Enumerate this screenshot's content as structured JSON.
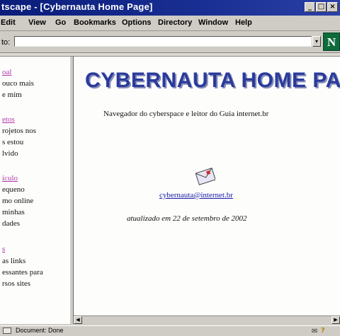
{
  "window": {
    "title": "tscape - [Cybernauta Home Page]",
    "controls": [
      "_",
      "□",
      "×"
    ]
  },
  "menu": [
    {
      "label": "Edit"
    },
    {
      "label": "View"
    },
    {
      "label": "Go"
    },
    {
      "label": "Bookmarks"
    },
    {
      "label": "Options"
    },
    {
      "label": "Directory"
    },
    {
      "label": "Window"
    },
    {
      "label": "Help"
    }
  ],
  "location": {
    "label": "to:",
    "value": "",
    "dropdown_icon": "▾",
    "logo": "N"
  },
  "sidebar": {
    "sections": [
      {
        "heading": "oal",
        "lines": [
          "ouco mais",
          "e mim"
        ]
      },
      {
        "heading": "etos",
        "lines": [
          "rojetos nos",
          "s estou",
          "lvido"
        ]
      },
      {
        "heading": "ículo",
        "lines": [
          "equeno",
          "mo online",
          "minhas",
          "dades"
        ]
      },
      {
        "heading": "s",
        "lines": [
          "as links",
          "essantes para",
          "rsos sites"
        ]
      }
    ]
  },
  "main": {
    "title": "CYBERNAUTA HOME PAGE",
    "subtitle": "Navegador do cyberspace e leitor do Guia internet.br",
    "email_icon": "envelope-icon",
    "email": "cybernauta@internet.br",
    "updated": "atualizado em 22 de setembro de 2002"
  },
  "status": {
    "text": "Document: Done",
    "mail_icon": "✉",
    "help_icon": "?"
  },
  "colors": {
    "titlebar": "#0a1d7a",
    "page_title": "#2a3b9c",
    "link": "#b03aa8",
    "email_link": "#1a1aa8"
  }
}
